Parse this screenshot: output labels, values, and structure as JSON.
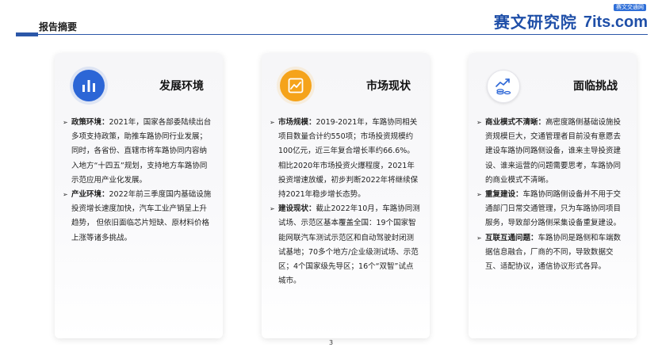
{
  "header": {
    "title": "报告摘要",
    "logo_cn": "赛文研究院",
    "logo_en": "7its.com",
    "logo_badge": "赛文交通网"
  },
  "cards": [
    {
      "title": "发展环境",
      "icon": "bar-chart-icon",
      "accent": "#2c66d6",
      "items": [
        {
          "label": "政策环境：",
          "text": "2021年，国家各部委陆续出台多项支持政策，助推车路协同行业发展；"
        },
        {
          "label": "",
          "text": "同时，各省份、直辖市将车路协同内容纳入地方“十四五”规划，支持地方车路协同示范应用产业化发展。"
        },
        {
          "label": "产业环境：",
          "text": "2022年前三季度国内基础设施投资增长速度加快，汽车工业产销呈上升趋势， 但依旧面临芯片短缺、原材料价格上涨等诸多挑战。"
        }
      ]
    },
    {
      "title": "市场现状",
      "icon": "line-chart-icon",
      "accent": "#f5a31a",
      "items": [
        {
          "label": "市场规模：",
          "text": "2019-2021年，车路协同相关项目数量合计约550项；市场投资规模约100亿元，近三年复合增长率约66.6%。"
        },
        {
          "label": "",
          "text": "相比2020年市场投资火爆程度，2021年投资增速放缓，初步判断2022年将继续保持2021年稳步增长态势。"
        },
        {
          "label": "建设现状：",
          "text": "截止2022年10月，车路协同测试场、示范区基本覆盖全国：19个国家智能网联汽车测试示范区和自动驾驶封闭测试基地；70多个地方/企业级测试场、示范区；4个国家级先导区；16个“双智”试点城市。"
        }
      ]
    },
    {
      "title": "面临挑战",
      "icon": "growth-coins-icon",
      "accent": "#2c66d6",
      "items": [
        {
          "label": "商业模式不清晰：",
          "text": "高密度路侧基础设施投资规模巨大，交通管理者目前没有意愿去建设车路协同路侧设备，谁来主导投资建设、谁来运营的问题需要思考，车路协同的商业模式不清晰。"
        },
        {
          "label": "重复建设：",
          "text": "车路协同路侧设备并不用于交通部门日常交通管理，只为车路协同项目服务，导致部分路侧采集设备重复建设。"
        },
        {
          "label": "互联互通问题：",
          "text": "车路协同是路侧和车端数据信息融合，厂商的不同，导致数据交互、适配协议，通信协议形式各异。"
        }
      ]
    }
  ],
  "page_number": "3"
}
